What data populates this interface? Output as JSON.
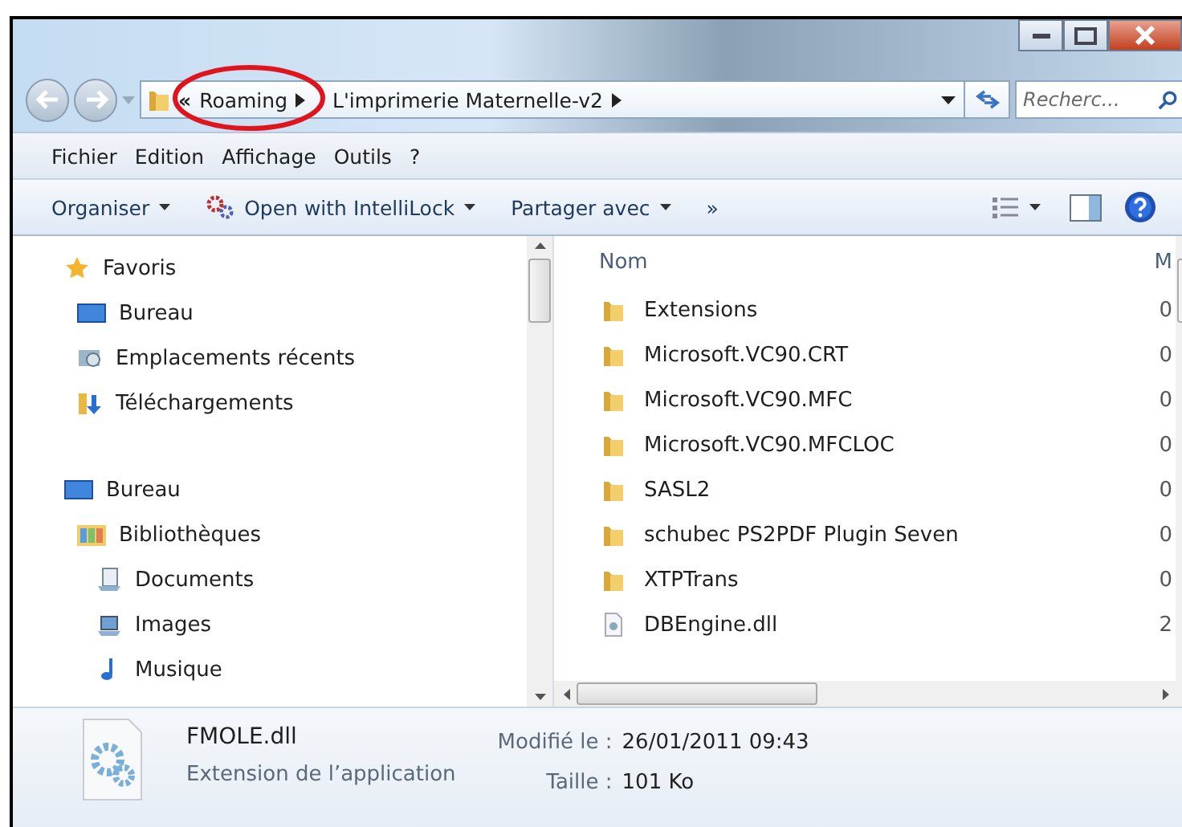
{
  "address": {
    "overflow": "«",
    "crumbs": [
      "Roaming",
      "L'imprimerie Maternelle-v2"
    ]
  },
  "search": {
    "placeholder": "Recherc..."
  },
  "menu": [
    "Fichier",
    "Edition",
    "Affichage",
    "Outils",
    "?"
  ],
  "toolbar": [
    {
      "label": "Organiser",
      "kind": "plain"
    },
    {
      "label": "Open with IntelliLock",
      "kind": "gears"
    },
    {
      "label": "Partager avec",
      "kind": "plain"
    }
  ],
  "toolbar_more": "»",
  "nav": [
    {
      "label": "Favoris",
      "kind": "star",
      "children": [
        {
          "label": "Bureau",
          "kind": "desktop"
        },
        {
          "label": "Emplacements récents",
          "kind": "recent"
        },
        {
          "label": "Téléchargements",
          "kind": "download"
        }
      ]
    },
    {
      "label": "Bureau",
      "kind": "desktop",
      "children": [
        {
          "label": "Bibliothèques",
          "kind": "library",
          "children": [
            {
              "label": "Documents",
              "kind": "docs"
            },
            {
              "label": "Images",
              "kind": "images"
            },
            {
              "label": "Musique",
              "kind": "music"
            }
          ]
        }
      ]
    }
  ],
  "columns": [
    "Nom",
    "M"
  ],
  "files": [
    {
      "name": "Extensions",
      "kind": "folder",
      "date": "0"
    },
    {
      "name": "Microsoft.VC90.CRT",
      "kind": "folder",
      "date": "0"
    },
    {
      "name": "Microsoft.VC90.MFC",
      "kind": "folder",
      "date": "0"
    },
    {
      "name": "Microsoft.VC90.MFCLOC",
      "kind": "folder",
      "date": "0"
    },
    {
      "name": "SASL2",
      "kind": "folder",
      "date": "0"
    },
    {
      "name": "schubec PS2PDF Plugin Seven",
      "kind": "folder",
      "date": "0"
    },
    {
      "name": "XTPTrans",
      "kind": "folder",
      "date": "0"
    },
    {
      "name": "DBEngine.dll",
      "kind": "file",
      "date": "2"
    }
  ],
  "details": {
    "name": "FMOLE.dll",
    "type": "Extension de l’application",
    "modified_label": "Modifié le :",
    "modified": "26/01/2011 09:43",
    "size_label": "Taille :",
    "size": "101 Ko"
  }
}
